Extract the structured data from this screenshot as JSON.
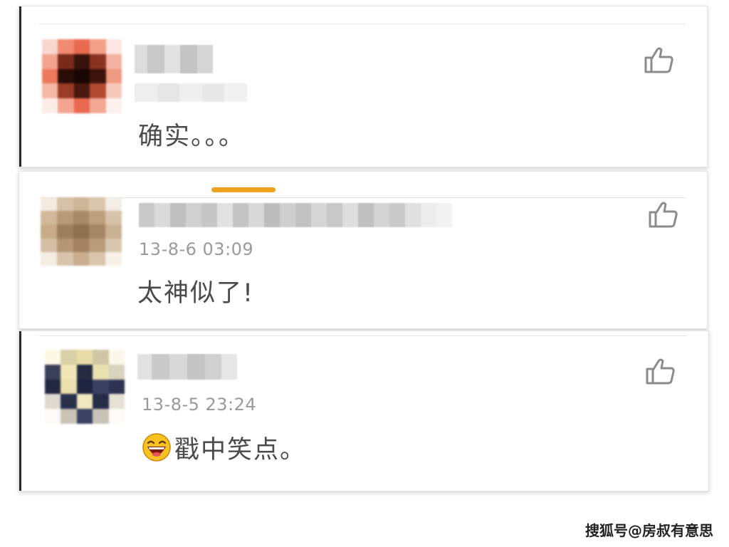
{
  "comments": [
    {
      "name": "",
      "timestamp": "",
      "text": "确实。。。",
      "avatar_colors": [
        "#f7d8d0",
        "#f08a70",
        "#e86a4e",
        "#f2a08a",
        "#fbe6e0",
        "#f3a48f",
        "#7a2a1c",
        "#3a120b",
        "#8a3322",
        "#f4b3a0",
        "#ee7a5c",
        "#2b0c07",
        "#1a0603",
        "#3d130c",
        "#f09a82",
        "#f5b8a6",
        "#9a3b27",
        "#4a180f",
        "#b24a33",
        "#f6c9bc",
        "#fcece7",
        "#f3a591",
        "#e86a4e",
        "#f2a894",
        "#fdf1ed"
      ],
      "like_icon": "thumbs-up-icon"
    },
    {
      "name": "",
      "timestamp": "13-8-6 03:09",
      "text": "太神似了!",
      "avatar_colors": [
        "#f3ebe2",
        "#d7c2a8",
        "#cdb697",
        "#d9c6ad",
        "#f4ede4",
        "#d2b99b",
        "#b89a79",
        "#a88a68",
        "#bda07f",
        "#d8c3aa",
        "#c7ab8b",
        "#9e7f5d",
        "#8f7050",
        "#a58665",
        "#cbb193",
        "#d5bfa4",
        "#b59775",
        "#a48463",
        "#b89b79",
        "#dac7af",
        "#f4ede4",
        "#d8c4ab",
        "#c9ae8f",
        "#d9c5ac",
        "#f6f0e8"
      ],
      "like_icon": "thumbs-up-icon"
    },
    {
      "name": "",
      "timestamp": "13-8-5 23:24",
      "text": "戳中笑点。",
      "emoji": "laughing-face-icon",
      "avatar_colors": [
        "#fdf7e6",
        "#d9cfa6",
        "#e8dca8",
        "#cfc7a4",
        "#fbf7ea",
        "#3a3f5a",
        "#f0e6b8",
        "#262b44",
        "#e9e0b0",
        "#d8d2bf",
        "#232842",
        "#eadfae",
        "#1f2440",
        "#3b4060",
        "#2d3350",
        "#dedad0",
        "#2a304c",
        "#f1e8bf",
        "#262c48",
        "#e6e1d4",
        "#fbfaf6",
        "#c9c4b6",
        "#3c4260",
        "#c8c3b6",
        "#fcfbf7"
      ],
      "like_icon": "thumbs-up-icon"
    }
  ],
  "colors": {
    "scroll_handle": "#f0a21e",
    "text": "#4a4a4a",
    "timestamp": "#9a9a9a",
    "icon": "#8c8c8c"
  },
  "watermark": "搜狐号@房叔有意思"
}
